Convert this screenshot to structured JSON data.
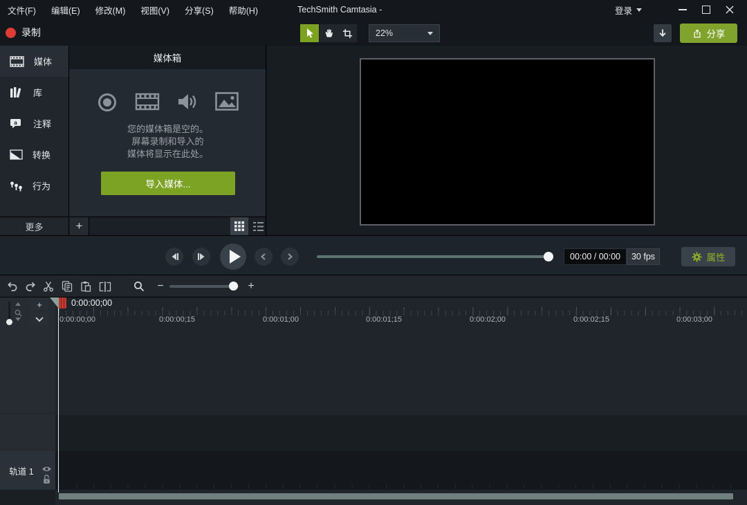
{
  "menu_bar": {
    "items": [
      "文件(F)",
      "编辑(E)",
      "修改(M)",
      "视图(V)",
      "分享(S)",
      "帮助(H)"
    ],
    "title": "TechSmith Camtasia -",
    "sign_in_label": "登录"
  },
  "toolbar": {
    "record_label": "录制",
    "zoom_level": "22%",
    "share_label": "分享"
  },
  "sidebar": {
    "items": [
      {
        "label": "媒体"
      },
      {
        "label": "库"
      },
      {
        "label": "注释"
      },
      {
        "label": "转换"
      },
      {
        "label": "行为"
      }
    ],
    "more_label": "更多"
  },
  "media_bin": {
    "title": "媒体箱",
    "empty_lines": [
      "您的媒体箱是空的。",
      "屏幕录制和导入的",
      "媒体将显示在此处。"
    ],
    "import_button_label": "导入媒体..."
  },
  "playback": {
    "time_display": "00:00 / 00:00",
    "fps_display": "30 fps",
    "properties_label": "属性"
  },
  "timeline": {
    "playhead_time": "0:00:00;00",
    "ruler_labels": [
      "0:00:00;00",
      "0:00:00;15",
      "0:00:01;00",
      "0:00:01;15",
      "0:00:02;00",
      "0:00:02;15",
      "0:00:03;00"
    ],
    "tracks": [
      {
        "name": "轨道 1"
      }
    ]
  },
  "icons": {
    "plus": "+",
    "minus": "−"
  },
  "colors": {
    "accent_green": "#7da21f",
    "button_green": "#80a42b",
    "record_red": "#e23b36",
    "playhead_flag_teal": "#86a39e",
    "playhead_marker_red": "#c4382f",
    "scrollbar_gray": "#6f7f7c",
    "properties_green": "#8db226"
  }
}
